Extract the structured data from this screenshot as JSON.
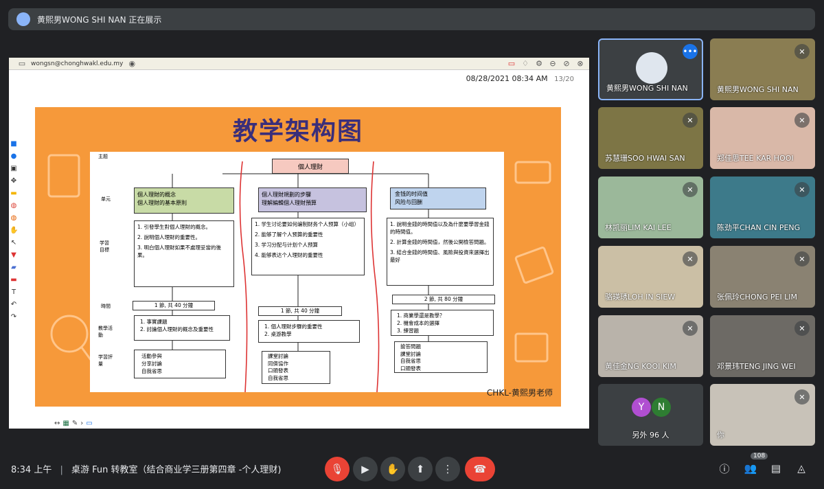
{
  "top_bar": {
    "presenter_label": "黄熙男WONG SHI NAN 正在展示"
  },
  "screen": {
    "account_email": "wongsn@chonghwakl.edu.my",
    "datetime": "08/28/2021  08:34 AM",
    "page": "13/20",
    "slide_title": "教学架构图",
    "watermark": "CHKL-黄熙男老师",
    "diagram": {
      "root": "個人理財",
      "row_labels": [
        "主题",
        "单元",
        "学習目標",
        "時間",
        "教學活動",
        "学習評量"
      ],
      "col1": {
        "unit": "個人理財的概念\n個人理財的基本原則",
        "goals": [
          "1. 引發學生對個人理財的概念。",
          "2. 說明個人理財的重要性。",
          "3. 明白個人理財如果不處理妥當的後果。"
        ],
        "time": "1 節, 共 40 分鐘",
        "activities": [
          "1. 事實課題",
          "2. 討論個人理財的概念及重要性"
        ],
        "assessment": [
          "活動參與",
          "分享討論",
          "自我省思"
        ]
      },
      "col2": {
        "unit": "個人理財規劃的步驟\n理解編輯個人理財預算",
        "goals": [
          "1. 学生讨论要如何编制财务个人预算（小组）",
          "2. 能够了解个人预算的重要性",
          "3. 学习分配与计划个人预算",
          "4. 能够表达个人理财的重要性"
        ],
        "time": "1 節, 共 40 分鐘",
        "activities": [
          "1. 個人理財步驟的重要性",
          "2. 桌游教學"
        ],
        "assessment": [
          "課堂討論",
          "同儕協作",
          "口頭發表",
          "自我省思"
        ]
      },
      "col3": {
        "unit": "金钱的时间值\n风险与回酬",
        "goals": [
          "1. 說明金錢的時間值以及為什麼要學習金錢的時間值。",
          "2. 計算金錢的時間值，然後公開檢答問題。",
          "3. 結合金錢的時間值、風險與投資來選擇出最好"
        ],
        "time": "2 節, 共 80 分鐘",
        "activities": [
          "1. 商業學還是教學？",
          "2. 機會成本的選擇",
          "3. 練習題"
        ],
        "assessment": [
          "搶答問題",
          "課堂討論",
          "自我省思",
          "口頭發表"
        ]
      }
    }
  },
  "participants": [
    {
      "name": "黄熙男WONG SHI NAN",
      "active": true,
      "bg": "#3c4043"
    },
    {
      "name": "黄熙男WONG SHI NAN",
      "active": false,
      "bg": "#8a7d52"
    },
    {
      "name": "苏慧珊SOO HWAI SAN",
      "active": false,
      "bg": "#7d7545"
    },
    {
      "name": "郑佳思TEE KAR HOOI",
      "active": false,
      "bg": "#d9b8a8"
    },
    {
      "name": "林凯丽LIM KAI LEE",
      "active": false,
      "bg": "#9bb89a"
    },
    {
      "name": "陈劲平CHAN CIN PENG",
      "active": false,
      "bg": "#3d7a8a"
    },
    {
      "name": "骆瑛琇LOH IN SIEW",
      "active": false,
      "bg": "#cbbfa5"
    },
    {
      "name": "张佩玲CHONG PEI LIM",
      "active": false,
      "bg": "#8a8272"
    },
    {
      "name": "黄佳金NG KOOI KIM",
      "active": false,
      "bg": "#b9b3aa"
    },
    {
      "name": "邓景玮TENG JING WEI",
      "active": false,
      "bg": "#6d6a65"
    },
    {
      "name": "另外 96 人",
      "active": false,
      "bg": "#3c4043"
    },
    {
      "name": "你",
      "active": false,
      "bg": "#c8c2b8"
    }
  ],
  "others": {
    "y": "Y",
    "n": "N",
    "y_color": "#b04fd1",
    "n_color": "#2e7d32"
  },
  "bottom": {
    "time": "8:34 上午",
    "meeting_title": "桌游 Fun 转教室（结合商业学三册第四章 -个人理财)",
    "people_count": "108"
  }
}
